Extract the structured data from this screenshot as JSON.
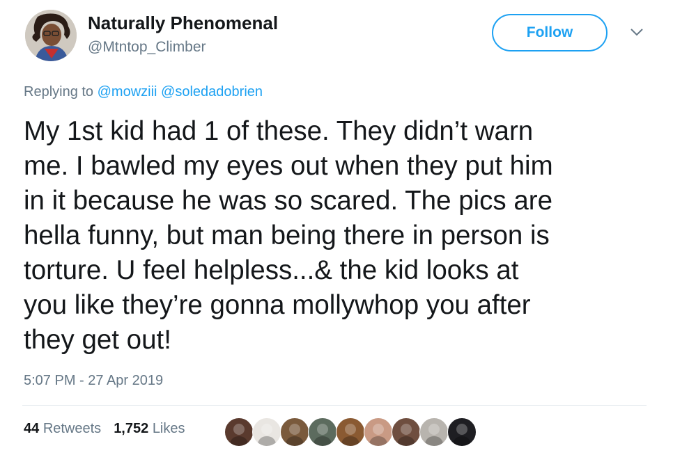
{
  "author": {
    "name": "Naturally Phenomenal",
    "handle": "@Mtntop_Climber",
    "avatar_icon": "profile-avatar-icon"
  },
  "follow_label": "Follow",
  "reply": {
    "prefix": "Replying to",
    "mentions": [
      "@mowziii",
      "@soledadobrien"
    ]
  },
  "tweet_lines": [
    "My 1st kid had 1 of these. They didn’t warn",
    "me. I bawled my eyes out when they put him",
    "in it because he was so scared. The pics are",
    "hella funny, but man being there in person is",
    "torture. U feel helpless...& the kid looks at",
    "you like they’re gonna mollywhop you after",
    "they get out!"
  ],
  "timestamp": "5:07 PM - 27 Apr 2019",
  "stats": {
    "retweets_count": "44",
    "retweets_label": "Retweets",
    "likes_count": "1,752",
    "likes_label": "Likes"
  },
  "likers": [
    {
      "icon": "liker-avatar-icon",
      "color": "#5a3a2e"
    },
    {
      "icon": "liker-avatar-icon",
      "color": "#e9e6e2"
    },
    {
      "icon": "liker-avatar-icon",
      "color": "#7a5a3c"
    },
    {
      "icon": "liker-avatar-icon",
      "color": "#5c6b5e"
    },
    {
      "icon": "liker-avatar-icon",
      "color": "#8a5a32"
    },
    {
      "icon": "liker-avatar-icon",
      "color": "#c99a84"
    },
    {
      "icon": "liker-avatar-icon",
      "color": "#6f4e3f"
    },
    {
      "icon": "liker-avatar-icon",
      "color": "#b8b4ae"
    },
    {
      "icon": "liker-avatar-icon",
      "color": "#1e1e22"
    }
  ],
  "colors": {
    "accent": "#1da1f2",
    "secondary_text": "#657786",
    "primary_text": "#14171a"
  }
}
